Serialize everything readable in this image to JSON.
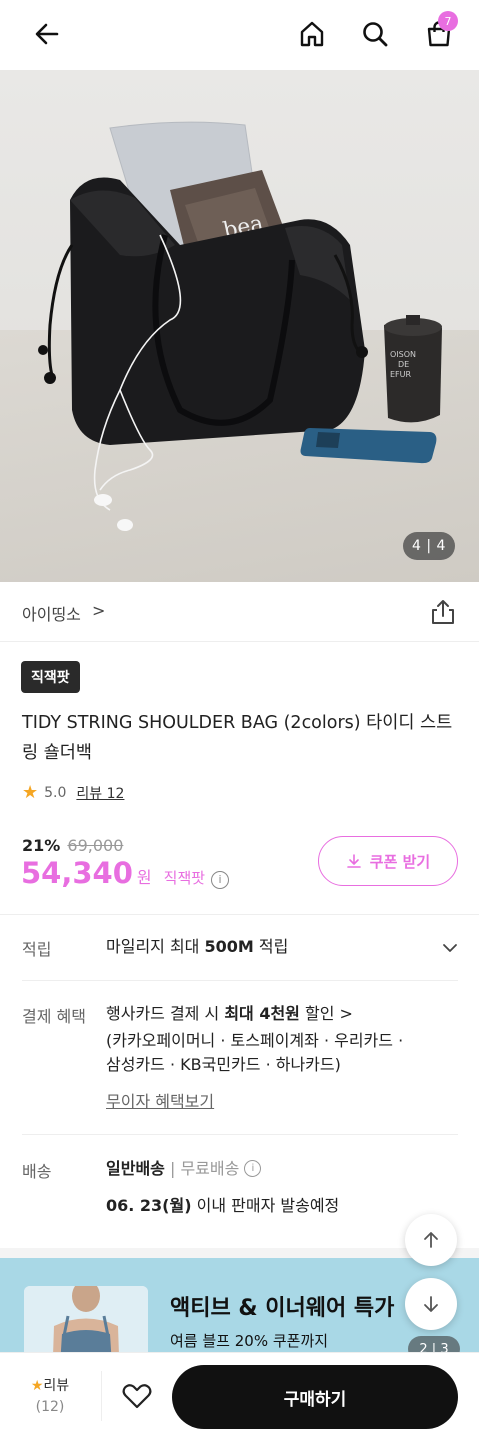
{
  "header": {
    "cart_count": "7"
  },
  "hero": {
    "counter": "4 | 4",
    "bag_text": "bea",
    "cup_text_1": "OISON",
    "cup_text_2": "DE",
    "cup_text_3": "EFUR"
  },
  "seller": {
    "name": "아이띵소",
    "chevron": ">"
  },
  "product": {
    "chip": "직잭팟",
    "title": "TIDY STRING SHOULDER BAG (2colors) 타이디 스트링 숄더백",
    "rating": "5.0",
    "review_link": "리뷰 12"
  },
  "pricing": {
    "discount_pct": "21%",
    "original_price": "69,000",
    "price": "54,340",
    "currency": "원",
    "price_tag": "직잭팟",
    "info_glyph": "i",
    "coupon_label": "쿠폰 받기"
  },
  "points": {
    "label": "적립",
    "prefix": "마일리지 최대 ",
    "amount": "500M",
    "suffix": " 적립"
  },
  "benefits": {
    "label": "결제 혜택",
    "line1_prefix": "행사카드 결제 시 ",
    "line1_bold": "최대 4천원",
    "line1_suffix": " 할인 >",
    "line2": "(카카오페이머니 · 토스페이계좌 · 우리카드 ·",
    "line3": "삼성카드 · KB국민카드 · 하나카드)",
    "link": "무이자 혜택보기"
  },
  "shipping": {
    "label": "배송",
    "type": "일반배송",
    "separator": " | ",
    "fee": "무료배송",
    "date": "06. 23(월)",
    "date_suffix": " 이내 판매자 발송예정"
  },
  "banner": {
    "headline": "액티브 & 이너웨어 특가",
    "subline": "여름 블프 20% 쿠폰까지",
    "pager": "2 | 3"
  },
  "bottom_bar": {
    "review_label": "리뷰",
    "review_count": "(12)",
    "buy_label": "구매하기"
  },
  "colors": {
    "accent": "#e86ee0",
    "star": "#f5a623",
    "banner_bg": "#a9d8e6",
    "buy_button": "#111111"
  },
  "icons": [
    "back-arrow-icon",
    "home-icon",
    "search-icon",
    "cart-icon",
    "share-icon",
    "star-icon",
    "info-icon",
    "download-icon",
    "chevron-down-icon",
    "arrow-up-icon",
    "arrow-down-icon",
    "heart-icon"
  ]
}
